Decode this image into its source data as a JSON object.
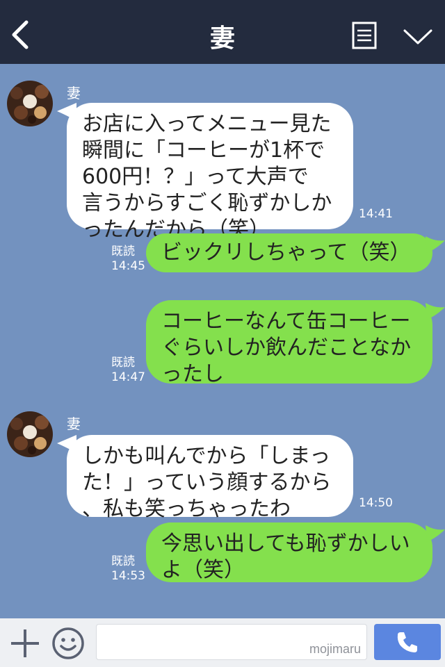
{
  "header": {
    "title": "妻",
    "icons": [
      "back-chevron-icon",
      "menu-list-icon",
      "chevron-down-icon"
    ]
  },
  "messages": [
    {
      "direction": "in",
      "sender": "妻",
      "lines": [
        "お店に入ってメニュー見た",
        "瞬間に「コーヒーが1杯で",
        "600円！？」って大声で",
        "言うからすごく恥ずかしか",
        "ったんだから（笑）"
      ],
      "time": "14:41"
    },
    {
      "direction": "out",
      "lines": [
        "ビックリしちゃって（笑）"
      ],
      "read": "既読",
      "time": "14:45"
    },
    {
      "direction": "out",
      "lines": [
        "コーヒーなんて缶コーヒー",
        "ぐらいしか飲んだことなか",
        "ったし"
      ],
      "read": "既読",
      "time": "14:47"
    },
    {
      "direction": "in",
      "sender": "妻",
      "lines": [
        "しかも叫んでから「しまっ",
        "た！」っていう顔するから",
        "、私も笑っちゃったわ"
      ],
      "time": "14:50"
    },
    {
      "direction": "out",
      "lines": [
        "今思い出しても恥ずかしい",
        "よ（笑）"
      ],
      "read": "既読",
      "time": "14:53"
    }
  ],
  "input": {
    "value": "",
    "watermark": "mojimaru"
  },
  "colors": {
    "header_bg": "#232b3e",
    "chat_bg": "#7392bf",
    "incoming_bubble": "#ffffff",
    "outgoing_bubble": "#84e04d",
    "send_button": "#5b86e0"
  },
  "bottom_icons": [
    "plus-icon",
    "smiley-icon",
    "phone-icon"
  ]
}
